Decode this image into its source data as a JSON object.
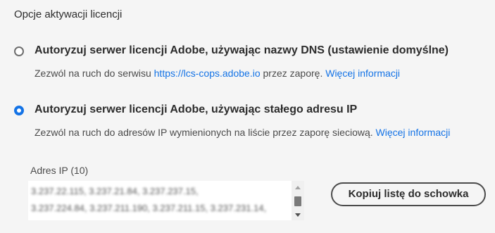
{
  "section": {
    "title": "Opcje aktywacji licencji"
  },
  "options": [
    {
      "label": "Autoryzuj serwer licencji Adobe, używając nazwy DNS (ustawienie domyślne)",
      "selected": false,
      "description_prefix": "Zezwól na ruch do serwisu ",
      "description_link_url_text": "https://lcs-cops.adobe.io",
      "description_middle": " przez zaporę. ",
      "more_info": "Więcej informacji"
    },
    {
      "label": "Autoryzuj serwer licencji Adobe, używając stałego adresu IP",
      "selected": true,
      "description_prefix": "Zezwól na ruch do adresów IP wymienionych na liście przez zaporę sieciową. ",
      "more_info": "Więcej informacji"
    }
  ],
  "ip_list": {
    "label": "Adres IP (10)",
    "line1": "3.237.22.115, 3.237.21.84, 3.237.237.15,",
    "line2": "3.237.224.84, 3.237.211.190, 3.237.211.15, 3.237.231.14,"
  },
  "copy_button": {
    "label": "Kopiuj listę do schowka"
  },
  "colors": {
    "accent": "#1473e6",
    "text": "#2c2c2c",
    "secondary_text": "#4b4b4b",
    "background": "#f5f5f5"
  }
}
